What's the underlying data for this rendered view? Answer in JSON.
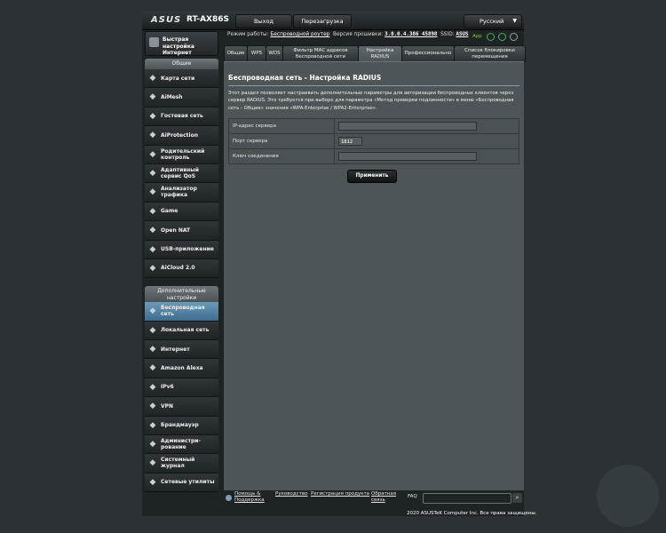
{
  "brand": {
    "logo": "ASUS",
    "model": "RT-AX86S"
  },
  "topbar": {
    "logout": "Выход",
    "reboot": "Перезагрузка",
    "language": "Русский"
  },
  "sidebar": {
    "quick_setup": "Быстрая настройка Интернет",
    "general_title": "Общие",
    "general": [
      {
        "label": "Карта сети",
        "icon": "network-map-icon"
      },
      {
        "label": "AiMesh",
        "icon": "aimesh-icon"
      },
      {
        "label": "Гостевая сеть",
        "icon": "guest-network-icon"
      },
      {
        "label": "AiProtection",
        "icon": "shield-icon"
      },
      {
        "label": "Родительский контроль",
        "icon": "parental-control-icon"
      },
      {
        "label": "Адаптивный сервис QoS",
        "icon": "qos-icon"
      },
      {
        "label": "Анализатор трафика",
        "icon": "traffic-analyzer-icon"
      },
      {
        "label": "Game",
        "icon": "gamepad-icon"
      },
      {
        "label": "Open NAT",
        "icon": "open-nat-icon"
      },
      {
        "label": "USB-приложение",
        "icon": "usb-icon"
      },
      {
        "label": "AiCloud 2.0",
        "icon": "cloud-icon"
      }
    ],
    "advanced_title": "Дополнительные настройки",
    "advanced": [
      {
        "label": "Беспроводная сеть",
        "icon": "wireless-icon"
      },
      {
        "label": "Локальная сеть",
        "icon": "lan-icon"
      },
      {
        "label": "Интернет",
        "icon": "globe-icon"
      },
      {
        "label": "Amazon Alexa",
        "icon": "alexa-icon"
      },
      {
        "label": "IPv6",
        "icon": "ipv6-icon"
      },
      {
        "label": "VPN",
        "icon": "vpn-icon"
      },
      {
        "label": "Брандмауэр",
        "icon": "firewall-icon"
      },
      {
        "label": "Администри-рование",
        "icon": "admin-icon"
      },
      {
        "label": "Системный журнал",
        "icon": "log-icon"
      },
      {
        "label": "Сетевые утилиты",
        "icon": "tools-icon"
      }
    ]
  },
  "info": {
    "mode_label": "Режим работы:",
    "mode_value": "Беспроводной роутер",
    "fw_label": "Версия прошивки:",
    "fw_value": "3.0.0.4.386_45898",
    "ssid_label": "SSID:",
    "ssid_value": "ASUS",
    "app_label": "App"
  },
  "tabs": [
    "Общие",
    "WPS",
    "WDS",
    "Фильтр MAC адресов беспроводной сети",
    "Настройка RADIUS",
    "Профессионально",
    "Список блокировки перемещения"
  ],
  "panel": {
    "title": "Беспроводная сеть - Настройка RADIUS",
    "description": "Этот раздел позволяет настраивать дополнительные параметры для авторизации беспроводных клиентов через сервер RADIUS. Это требуется при выборе для параметра «Метод проверки подлинности» в меню «Беспроводная сеть - Общие» значения «WPA-Enterprise / WPA2-Enterprise».",
    "fields": [
      {
        "label": "IP-адрес сервера",
        "value": ""
      },
      {
        "label": "Порт сервера",
        "value": "1812"
      },
      {
        "label": "Ключ соединения",
        "value": ""
      }
    ],
    "apply": "Применить"
  },
  "footer": {
    "help": "Помощь & Поддержка",
    "manual": "Руководство",
    "registration": "Регистрация продукта",
    "feedback": "Обратная связь",
    "faq": "FAQ",
    "copyright": "2020 ASUSTeK Computer Inc. Все права защищены."
  }
}
